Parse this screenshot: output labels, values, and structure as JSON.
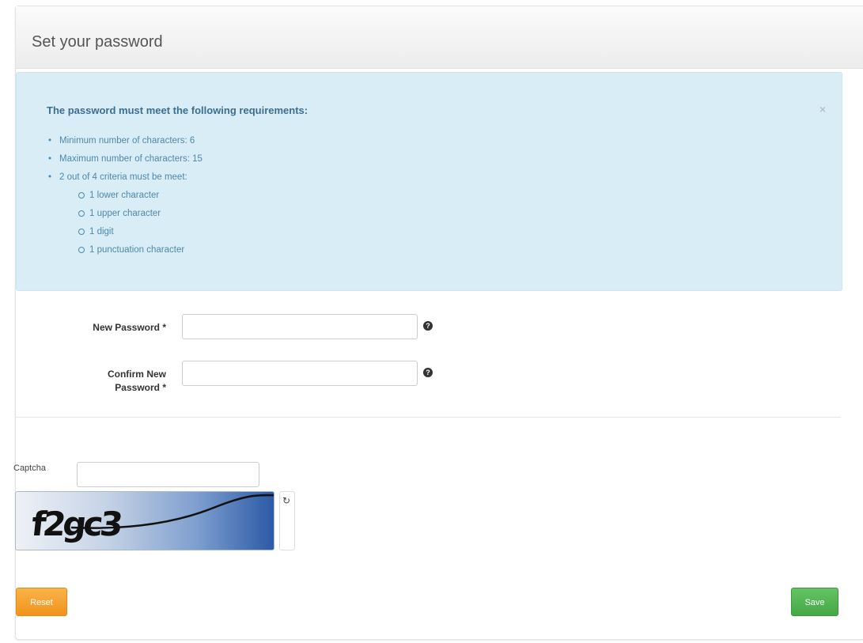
{
  "panel": {
    "title": "Set your password"
  },
  "alert": {
    "close_glyph": "×",
    "heading": "The password must meet the following requirements:",
    "requirements": [
      "Minimum number of characters: 6",
      "Maximum number of characters: 15",
      "2 out of 4 criteria must be meet:"
    ],
    "criteria": [
      "1 lower character",
      "1 upper character",
      "1 digit",
      "1 punctuation character"
    ]
  },
  "form": {
    "new_password_label": "New Password *",
    "new_password_value": "",
    "confirm_password_label_line1": "Confirm New",
    "confirm_password_label_line2": "Password *",
    "confirm_password_value": "",
    "help_glyph": "?"
  },
  "captcha": {
    "label": "Captcha",
    "value": "",
    "image_text": "f2gc3",
    "refresh_glyph": "↻"
  },
  "buttons": {
    "reset_label": "Reset",
    "save_label": "Save"
  },
  "colors": {
    "alert_bg": "#d9edf7",
    "reset_orange": "#f0931c",
    "save_green": "#45a745"
  }
}
